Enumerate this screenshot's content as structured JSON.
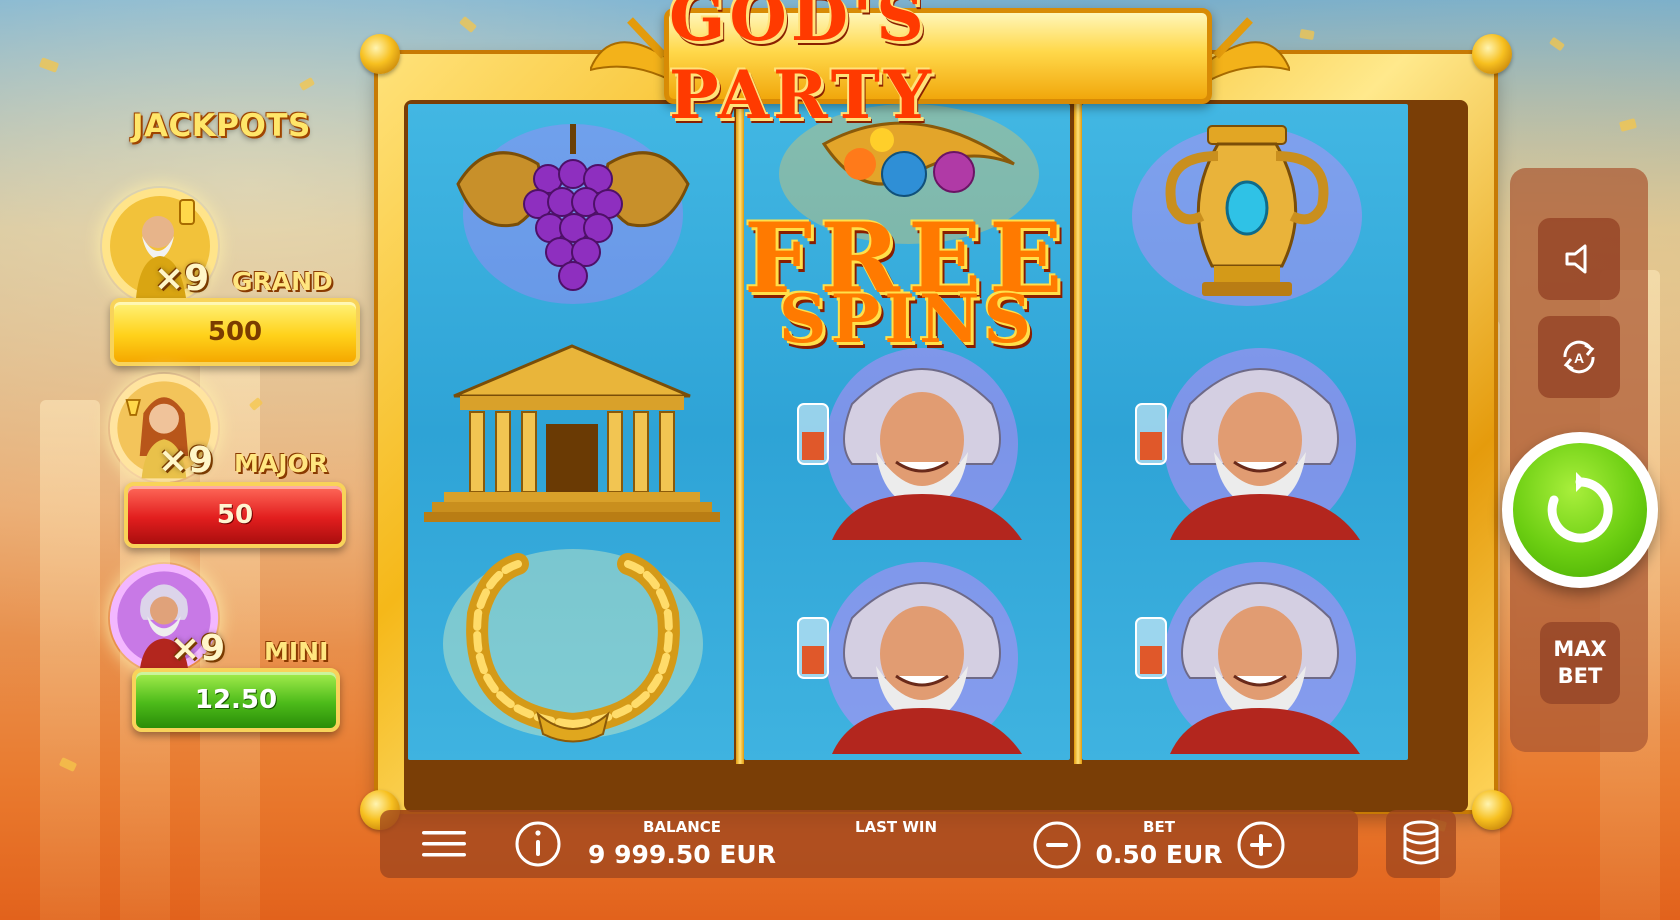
{
  "game": {
    "title": "GOD'S PARTY"
  },
  "jackpots": {
    "heading": "JACKPOTS",
    "tiers": [
      {
        "multiplier": "×9",
        "name": "GRAND",
        "value": "500"
      },
      {
        "multiplier": "×9",
        "name": "MAJOR",
        "value": "50"
      },
      {
        "multiplier": "×9",
        "name": "MINI",
        "value": "12.50"
      }
    ]
  },
  "reels": {
    "feature_text_top": "FREE",
    "feature_text_bottom": "SPINS",
    "columns": [
      [
        "grapes",
        "temple",
        "laurel-wreath"
      ],
      [
        "free-spins",
        "dionysus",
        "dionysus"
      ],
      [
        "golden-vase",
        "dionysus",
        "dionysus"
      ]
    ]
  },
  "controls": {
    "max_bet_line1": "MAX",
    "max_bet_line2": "BET",
    "sound_icon": "speaker-icon",
    "autoplay_icon": "autoplay-icon",
    "spin_icon": "spin-arrow-icon"
  },
  "bottom_bar": {
    "balance_label": "BALANCE",
    "balance_value": "9 999.50 EUR",
    "last_win_label": "LAST WIN",
    "last_win_value": "",
    "bet_label": "BET",
    "bet_value": "0.50 EUR"
  },
  "colors": {
    "gold": "#f5b819",
    "spin_green": "#6cce12",
    "grand": "#ffd21b",
    "major": "#e21e1e",
    "mini": "#4dbb1a",
    "reel_blue": "#2ea3d6"
  }
}
